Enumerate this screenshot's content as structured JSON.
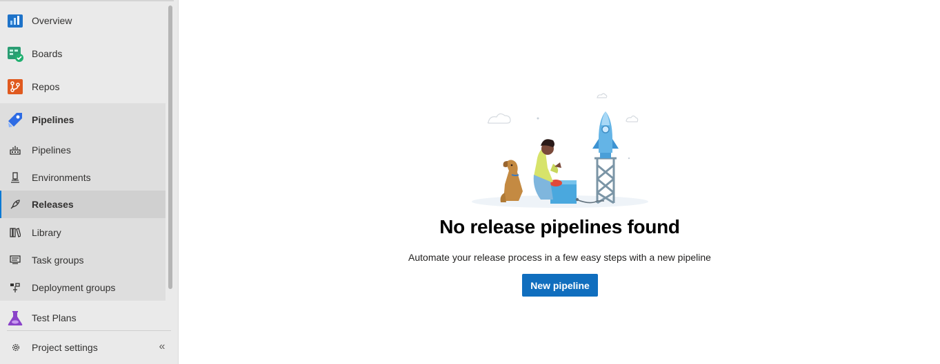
{
  "sidebar": {
    "items": [
      {
        "label": "Overview",
        "icon": "overview-icon"
      },
      {
        "label": "Boards",
        "icon": "boards-icon"
      },
      {
        "label": "Repos",
        "icon": "repos-icon"
      },
      {
        "label": "Pipelines",
        "icon": "pipelines-icon"
      },
      {
        "label": "Test Plans",
        "icon": "test-plans-icon"
      }
    ],
    "pipelines_sub": [
      {
        "label": "Pipelines",
        "icon": "pipeline-build-icon"
      },
      {
        "label": "Environments",
        "icon": "environments-icon"
      },
      {
        "label": "Releases",
        "icon": "rocket-icon",
        "selected": true
      },
      {
        "label": "Library",
        "icon": "library-icon"
      },
      {
        "label": "Task groups",
        "icon": "task-groups-icon"
      },
      {
        "label": "Deployment groups",
        "icon": "deployment-groups-icon"
      }
    ],
    "settings_label": "Project settings",
    "collapse_glyph": "«"
  },
  "main": {
    "title": "No release pipelines found",
    "description": "Automate your release process in a few easy steps with a new pipeline",
    "button_label": "New pipeline"
  },
  "colors": {
    "accent": "#0078d4",
    "button": "#106ebe",
    "sidebar_bg": "#eaeaea",
    "selected_bg": "#d0d0d0"
  }
}
